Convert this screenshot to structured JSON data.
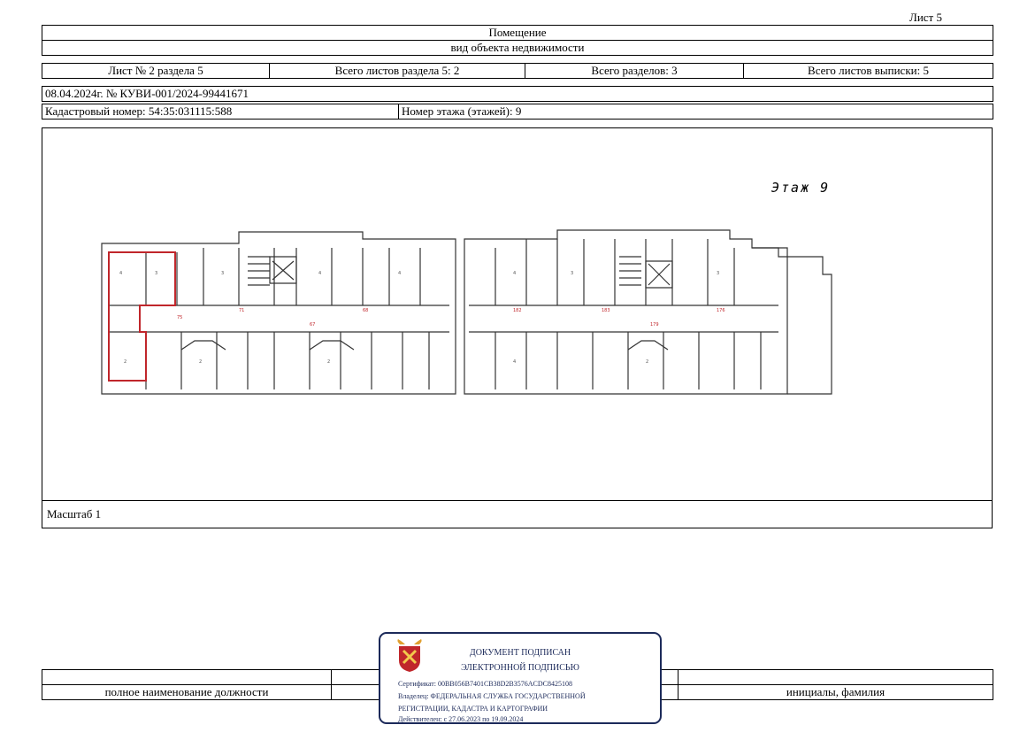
{
  "sheet_label": "Лист 5",
  "header": {
    "title": "Помещение",
    "subtitle": "вид объекта недвижимости"
  },
  "section_row": {
    "sheet_of_section": "Лист № 2 раздела 5",
    "total_sheets_section": "Всего листов раздела 5: 2",
    "total_sections": "Всего разделов: 3",
    "total_sheets_extract": "Всего листов выписки: 5"
  },
  "extract_id": "08.04.2024г. № КУВИ-001/2024-99441671",
  "cadastral_number": "Кадастровый номер: 54:35:031115:588",
  "floor_numbers": "Номер этажа (этажей): 9",
  "plan": {
    "floor_label": "Этаж 9"
  },
  "scale": "Масштаб 1",
  "signature": {
    "position_caption": "полное наименование должности",
    "name_caption": "инициалы, фамилия"
  },
  "stamp": {
    "line1": "ДОКУМЕНТ ПОДПИСАН",
    "line2": "ЭЛЕКТРОННОЙ ПОДПИСЬЮ",
    "certificate": "Сертификат: 00BB056B7401CB38D2B3576ACDC8425108",
    "owner_line1": "Владелец: ФЕДЕРАЛЬНАЯ СЛУЖБА ГОСУДАРСТВЕННОЙ",
    "owner_line2": "РЕГИСТРАЦИИ, КАДАСТРА И КАРТОГРАФИИ",
    "valid": "Действителен: с 27.06.2023 по 19.09.2024"
  },
  "colors": {
    "highlight": "#c0262b",
    "stamp": "#1c2a5a"
  }
}
